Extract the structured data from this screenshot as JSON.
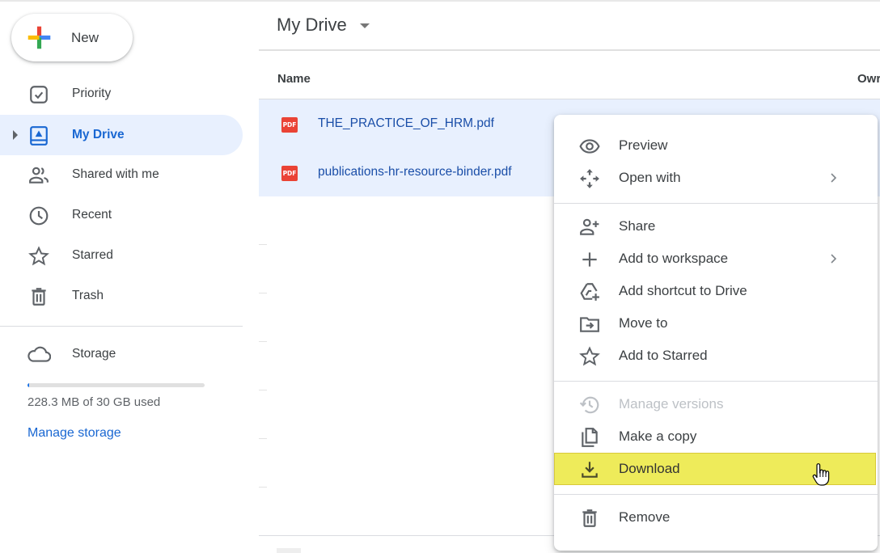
{
  "sidebar": {
    "new_button": "New",
    "items": [
      {
        "label": "Priority",
        "icon": "priority-check-icon",
        "active": false
      },
      {
        "label": "My Drive",
        "icon": "my-drive-icon",
        "active": true
      },
      {
        "label": "Shared with me",
        "icon": "shared-people-icon",
        "active": false
      },
      {
        "label": "Recent",
        "icon": "clock-icon",
        "active": false
      },
      {
        "label": "Starred",
        "icon": "star-icon",
        "active": false
      },
      {
        "label": "Trash",
        "icon": "trash-icon",
        "active": false
      }
    ],
    "storage": {
      "label": "Storage",
      "used_text": "228.3 MB of 30 GB used",
      "used_fraction": 0.0074,
      "manage_link": "Manage storage"
    }
  },
  "main": {
    "title": "My Drive",
    "columns": {
      "name": "Name",
      "owner": "Owr"
    },
    "files": [
      {
        "name": "THE_PRACTICE_OF_HRM.pdf",
        "type": "PDF",
        "selected": true
      },
      {
        "name": "publications-hr-resource-binder.pdf",
        "type": "PDF",
        "selected": true
      }
    ]
  },
  "context_menu": {
    "groups": [
      [
        {
          "label": "Preview",
          "icon": "eye-icon",
          "submenu": false,
          "disabled": false
        },
        {
          "label": "Open with",
          "icon": "open-with-arrows-icon",
          "submenu": true,
          "disabled": false
        }
      ],
      [
        {
          "label": "Share",
          "icon": "person-add-icon",
          "submenu": false,
          "disabled": false
        },
        {
          "label": "Add to workspace",
          "icon": "plus-icon",
          "submenu": true,
          "disabled": false
        },
        {
          "label": "Add shortcut to Drive",
          "icon": "drive-shortcut-icon",
          "submenu": false,
          "disabled": false
        },
        {
          "label": "Move to",
          "icon": "move-folder-icon",
          "submenu": false,
          "disabled": false
        },
        {
          "label": "Add to Starred",
          "icon": "star-icon",
          "submenu": false,
          "disabled": false
        }
      ],
      [
        {
          "label": "Manage versions",
          "icon": "history-icon",
          "submenu": false,
          "disabled": true
        },
        {
          "label": "Make a copy",
          "icon": "copy-icon",
          "submenu": false,
          "disabled": false
        },
        {
          "label": "Download",
          "icon": "download-icon",
          "submenu": false,
          "disabled": false,
          "highlighted": true
        }
      ],
      [
        {
          "label": "Remove",
          "icon": "trash-icon",
          "submenu": false,
          "disabled": false
        }
      ]
    ]
  },
  "colors": {
    "accent_blue": "#1967d2",
    "selection_bg": "#e8f0fe",
    "pdf_red": "#ea4335",
    "highlight_yellow": "#eeeb5a"
  }
}
